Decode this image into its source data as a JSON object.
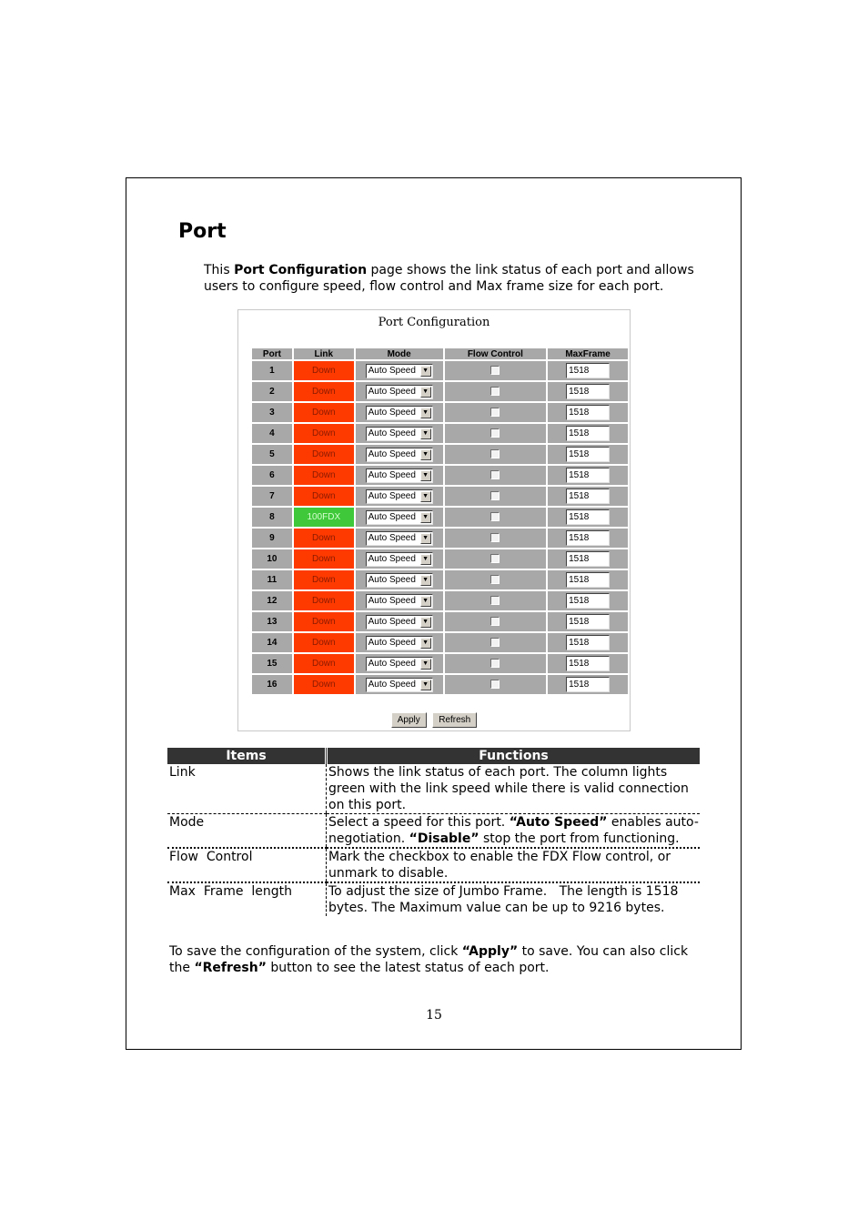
{
  "heading": "Port",
  "intro": {
    "prefix": "This ",
    "bold": "Port Configuration",
    "suffix": " page shows the link status of each port and allows users to configure speed, flow control and Max frame size for each port."
  },
  "screenshot": {
    "title": "Port Configuration",
    "columns": [
      "Port",
      "Link",
      "Mode",
      "Flow Control",
      "MaxFrame"
    ],
    "rows": [
      {
        "port": "1",
        "link": "Down",
        "mode": "Auto Speed",
        "flow_control": false,
        "max_frame": "1518"
      },
      {
        "port": "2",
        "link": "Down",
        "mode": "Auto Speed",
        "flow_control": false,
        "max_frame": "1518"
      },
      {
        "port": "3",
        "link": "Down",
        "mode": "Auto Speed",
        "flow_control": false,
        "max_frame": "1518"
      },
      {
        "port": "4",
        "link": "Down",
        "mode": "Auto Speed",
        "flow_control": false,
        "max_frame": "1518"
      },
      {
        "port": "5",
        "link": "Down",
        "mode": "Auto Speed",
        "flow_control": false,
        "max_frame": "1518"
      },
      {
        "port": "6",
        "link": "Down",
        "mode": "Auto Speed",
        "flow_control": false,
        "max_frame": "1518"
      },
      {
        "port": "7",
        "link": "Down",
        "mode": "Auto Speed",
        "flow_control": false,
        "max_frame": "1518"
      },
      {
        "port": "8",
        "link": "100FDX",
        "mode": "Auto Speed",
        "flow_control": false,
        "max_frame": "1518"
      },
      {
        "port": "9",
        "link": "Down",
        "mode": "Auto Speed",
        "flow_control": false,
        "max_frame": "1518"
      },
      {
        "port": "10",
        "link": "Down",
        "mode": "Auto Speed",
        "flow_control": false,
        "max_frame": "1518"
      },
      {
        "port": "11",
        "link": "Down",
        "mode": "Auto Speed",
        "flow_control": false,
        "max_frame": "1518"
      },
      {
        "port": "12",
        "link": "Down",
        "mode": "Auto Speed",
        "flow_control": false,
        "max_frame": "1518"
      },
      {
        "port": "13",
        "link": "Down",
        "mode": "Auto Speed",
        "flow_control": false,
        "max_frame": "1518"
      },
      {
        "port": "14",
        "link": "Down",
        "mode": "Auto Speed",
        "flow_control": false,
        "max_frame": "1518"
      },
      {
        "port": "15",
        "link": "Down",
        "mode": "Auto Speed",
        "flow_control": false,
        "max_frame": "1518"
      },
      {
        "port": "16",
        "link": "Down",
        "mode": "Auto Speed",
        "flow_control": false,
        "max_frame": "1518"
      }
    ],
    "apply_label": "Apply",
    "refresh_label": "Refresh",
    "colors": {
      "link_down": "#ff3a00",
      "link_up": "#3ec83a",
      "cell_bg": "#a8a8a8"
    }
  },
  "items_table": {
    "headers": {
      "items": "Items",
      "functions": "Functions"
    },
    "rows": [
      {
        "item": "Link",
        "function_html": "Shows the link status of each port. The column lights green with the link speed while there is valid connection on this port."
      },
      {
        "item": "Mode",
        "function_html": "Select a speed for this port. <b>“Auto Speed”</b> enables auto-negotiation. <b>“Disable”</b> stop the port from functioning."
      },
      {
        "item": "Flow  Control",
        "function_html": "Mark the checkbox to enable the FDX Flow control, or unmark to disable."
      },
      {
        "item": "Max  Frame  length",
        "function_html": "To adjust the size of Jumbo Frame.&nbsp;&nbsp; The length is 1518 bytes. The Maximum value can be up to 9216 bytes."
      }
    ]
  },
  "outro": {
    "part1": "To save the configuration of the system, click ",
    "apply_bold": "“Apply”",
    "part2": " to save. You can also click the ",
    "refresh_bold": "“Refresh”",
    "part3": " button to see the latest status of each port."
  },
  "page_number": "15"
}
